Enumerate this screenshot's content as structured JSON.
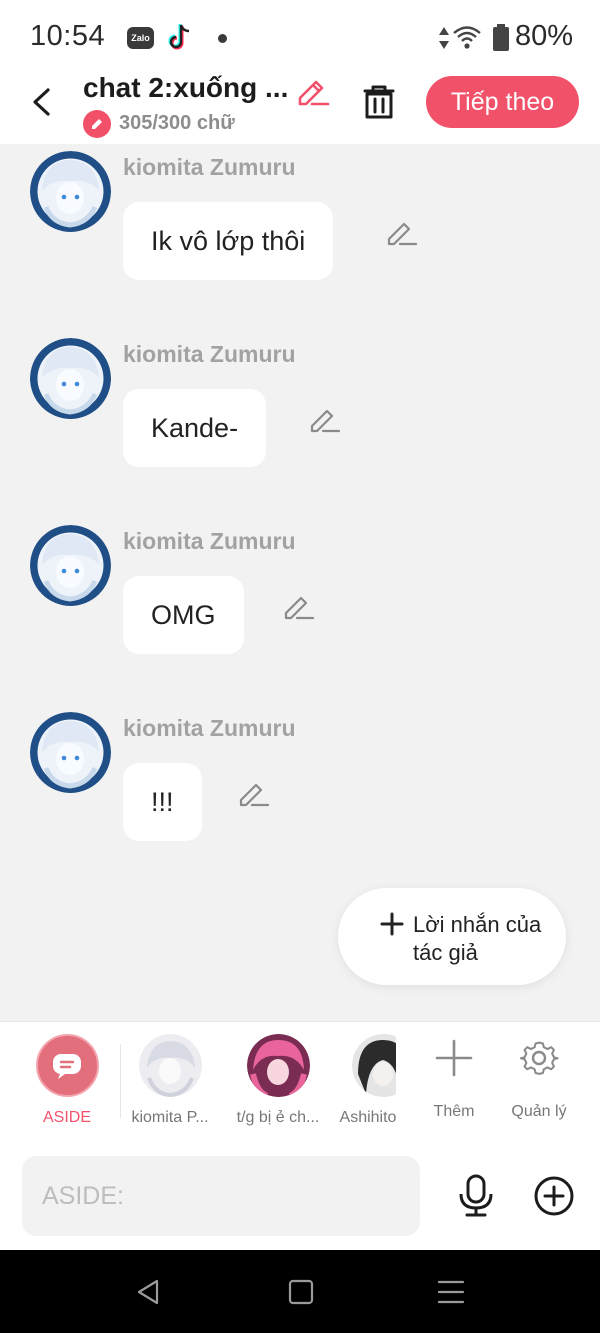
{
  "status_bar": {
    "time": "10:54",
    "zalo_label": "Zalo",
    "battery": "80%"
  },
  "header": {
    "title": "chat 2:xuống ...",
    "char_count": "305/300 chữ",
    "next_button": "Tiếp theo"
  },
  "messages": [
    {
      "name": "kiomita Zumuru",
      "text": "Ik vô lớp thôi"
    },
    {
      "name": "kiomita Zumuru",
      "text": "Kande-"
    },
    {
      "name": "kiomita Zumuru",
      "text": "OMG"
    },
    {
      "name": "kiomita Zumuru",
      "text": "!!!"
    }
  ],
  "author_note": {
    "label": "Lời nhắn của tác giả"
  },
  "characters": [
    {
      "label": "ASIDE",
      "selected": true
    },
    {
      "label": "kiomita P..."
    },
    {
      "label": "t/g bị ẻ ch..."
    },
    {
      "label": "Ashihito"
    }
  ],
  "actions": {
    "add_label": "Thêm",
    "manage_label": "Quản lý"
  },
  "composer": {
    "placeholder": "ASIDE:"
  },
  "colors": {
    "accent": "#f2516a",
    "aside": "#e36f7c",
    "background": "#f2f2f2"
  },
  "icons": [
    "back-arrow-icon",
    "pencil-icon",
    "trash-icon",
    "plus-icon",
    "gear-icon",
    "mic-icon",
    "plus-circle-icon"
  ]
}
